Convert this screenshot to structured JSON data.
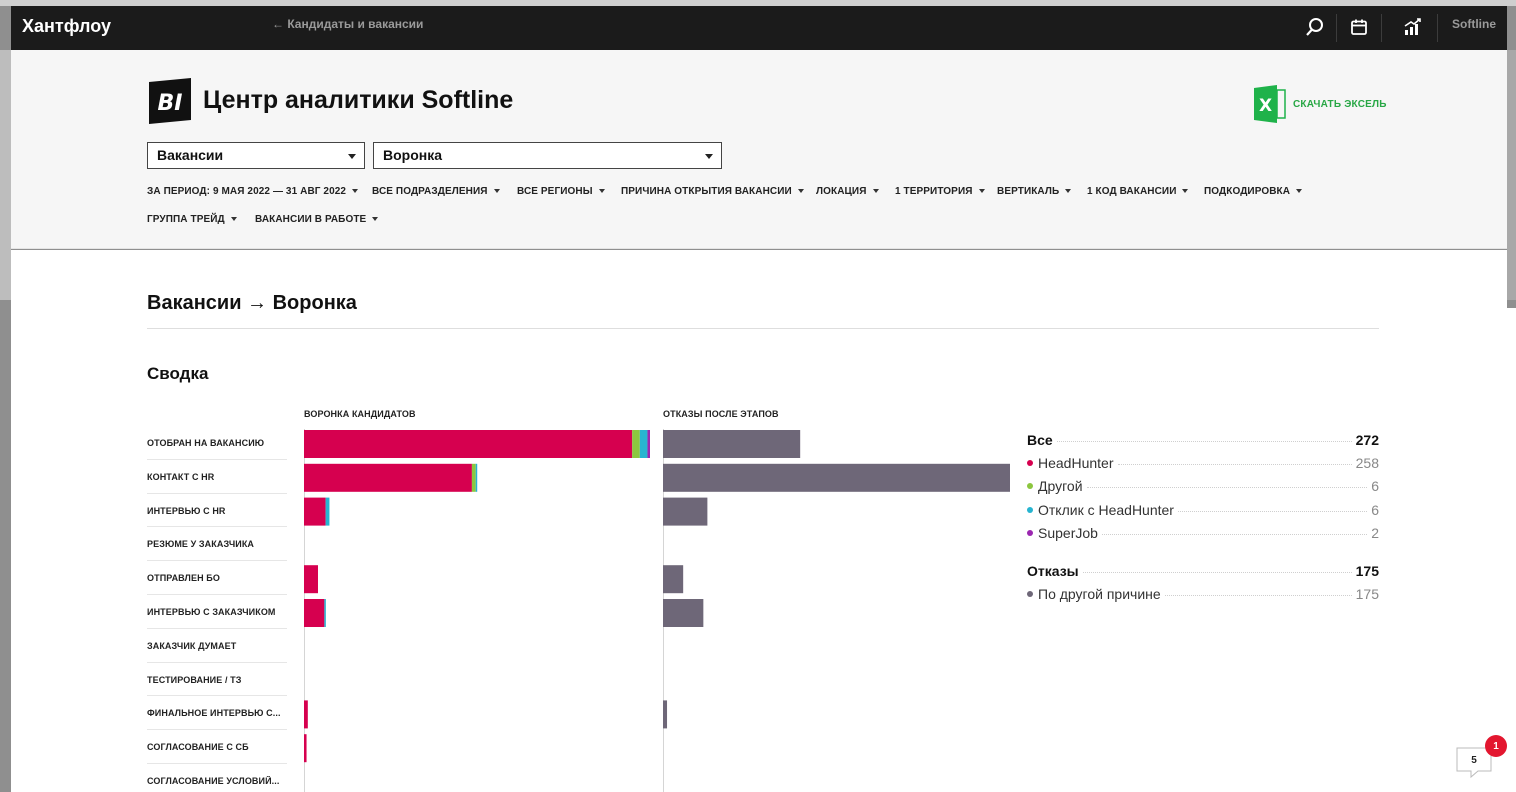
{
  "header": {
    "logo": "Хантфлоу",
    "back_link": "← Кандидаты и вакансии",
    "account": "Softline",
    "icons": [
      "search-icon",
      "calendar-icon",
      "analytics-icon"
    ]
  },
  "page": {
    "title": "Центр аналитики Softline",
    "bi_label": "BI",
    "excel_label": "СКАЧАТЬ ЭКСЕЛЬ",
    "excel_letter": "X"
  },
  "selects": {
    "entity": "Вакансии",
    "report": "Воронка"
  },
  "filters": [
    "ЗА ПЕРИОД: 9 МАЯ 2022 — 31 АВГ 2022",
    "ВСЕ ПОДРАЗДЕЛЕНИЯ",
    "ВСЕ РЕГИОНЫ",
    "ПРИЧИНА ОТКРЫТИЯ ВАКАНСИИ",
    "ЛОКАЦИЯ",
    "1 ТЕРРИТОРИЯ",
    "ВЕРТИКАЛЬ",
    "1 КОД ВАКАНСИИ",
    "ПОДКОДИРОВКА",
    "ГРУППА ТРЕЙД",
    "ВАКАНСИИ В РАБОТЕ"
  ],
  "section": {
    "title": "Вакансии → Воронка",
    "summary": "Сводка"
  },
  "colors": {
    "headhunter": "#d6004f",
    "other": "#8cc63f",
    "hh_response": "#27b4d0",
    "superjob": "#9b27b0",
    "rejects": "#6e6778",
    "excel": "#1fb24a",
    "badge": "#e3162f"
  },
  "chart_data": {
    "type": "bar",
    "headers": [
      "ВОРОНКА КАНДИДАТОВ",
      "ОТКАЗЫ ПОСЛЕ ЭТАПОВ"
    ],
    "stages": [
      "ОТОБРАН НА ВАКАНСИЮ",
      "КОНТАКТ С HR",
      "ИНТЕРВЬЮ С HR",
      "РЕЗЮМЕ У ЗАКАЗЧИКА",
      "ОТПРАВЛЕН БО",
      "ИНТЕРВЬЮ С ЗАКАЗЧИКОМ",
      "ЗАКАЗЧИК ДУМАЕТ",
      "ТЕСТИРОВАНИЕ / ТЗ",
      "ФИНАЛЬНОЕ ИНТЕРВЬЮ С...",
      "СОГЛАСОВАНИЕ С СБ",
      "СОГЛАСОВАНИЕ УСЛОВИЙ..."
    ],
    "funnel_series": [
      {
        "name": "HeadHunter",
        "color_key": "headhunter",
        "values": [
          258,
          132,
          17,
          0,
          11,
          16,
          0,
          0,
          3,
          2,
          0
        ]
      },
      {
        "name": "Другой",
        "color_key": "other",
        "values": [
          6,
          3,
          0,
          0,
          0,
          0,
          0,
          0,
          0,
          0,
          0
        ]
      },
      {
        "name": "Отклик с HeadHunter",
        "color_key": "hh_response",
        "values": [
          6,
          1,
          3,
          0,
          0,
          1,
          0,
          0,
          0,
          0,
          0
        ]
      },
      {
        "name": "SuperJob",
        "color_key": "superjob",
        "values": [
          2,
          0,
          0,
          0,
          0,
          0,
          0,
          0,
          0,
          0,
          0
        ]
      }
    ],
    "funnel_max": 272,
    "rejects_series": {
      "name": "По другой причине",
      "color_key": "rejects",
      "values": [
        34,
        86,
        11,
        0,
        5,
        10,
        0,
        0,
        1,
        0,
        0
      ]
    },
    "rejects_max": 86
  },
  "legend": {
    "all_label": "Все",
    "all_total": "272",
    "sources": [
      {
        "name": "HeadHunter",
        "value": "258",
        "color_key": "headhunter"
      },
      {
        "name": "Другой",
        "value": "6",
        "color_key": "other"
      },
      {
        "name": "Отклик с HeadHunter",
        "value": "6",
        "color_key": "hh_response"
      },
      {
        "name": "SuperJob",
        "value": "2",
        "color_key": "superjob"
      }
    ],
    "rejects_label": "Отказы",
    "rejects_total": "175",
    "reject_reasons": [
      {
        "name": "По другой причине",
        "value": "175",
        "color_key": "rejects"
      }
    ]
  },
  "chat": {
    "count": "5",
    "badge": "1"
  }
}
